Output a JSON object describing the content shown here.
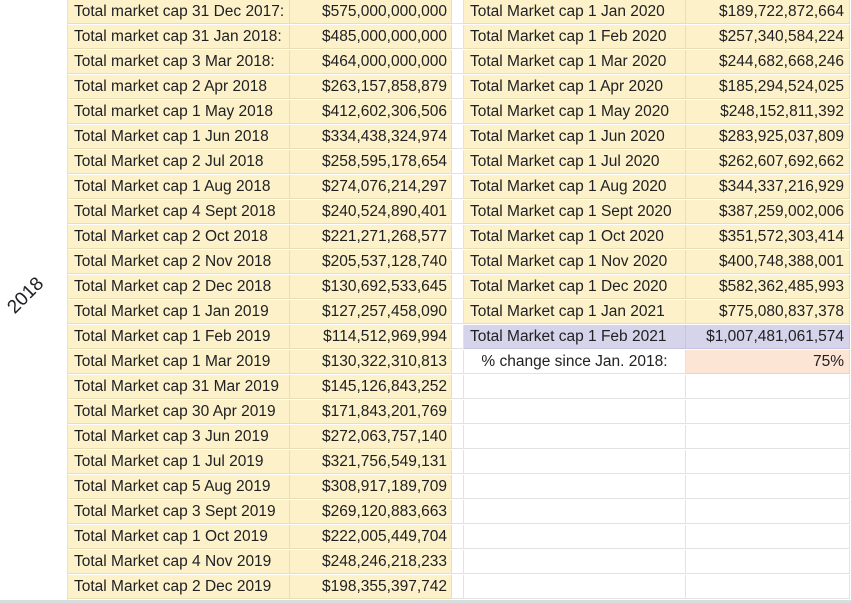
{
  "group_label": "2018",
  "left_table": [
    {
      "label": "Total market cap 31 Dec 2017:",
      "value": "$575,000,000,000"
    },
    {
      "label": "Total market cap 31 Jan 2018:",
      "value": "$485,000,000,000"
    },
    {
      "label": "Total market cap 3 Mar 2018:",
      "value": "$464,000,000,000"
    },
    {
      "label": "Total market cap 2 Apr 2018",
      "value": "$263,157,858,879"
    },
    {
      "label": "Total market cap 1 May 2018",
      "value": "$412,602,306,506"
    },
    {
      "label": "Total Market cap 1 Jun 2018",
      "value": "$334,438,324,974"
    },
    {
      "label": "Total Market cap 2 Jul 2018",
      "value": "$258,595,178,654"
    },
    {
      "label": "Total Market cap 1 Aug 2018",
      "value": "$274,076,214,297"
    },
    {
      "label": "Total Market cap 4 Sept 2018",
      "value": "$240,524,890,401"
    },
    {
      "label": "Total Market cap 2 Oct 2018",
      "value": "$221,271,268,577"
    },
    {
      "label": "Total Market cap 2 Nov 2018",
      "value": "$205,537,128,740"
    },
    {
      "label": "Total Market cap 2 Dec 2018",
      "value": "$130,692,533,645"
    },
    {
      "label": "Total Market cap 1 Jan 2019",
      "value": "$127,257,458,090"
    },
    {
      "label": "Total Market cap 1 Feb 2019",
      "value": "$114,512,969,994"
    },
    {
      "label": "Total Market cap 1 Mar 2019",
      "value": "$130,322,310,813"
    },
    {
      "label": "Total Market cap 31 Mar 2019",
      "value": "$145,126,843,252"
    },
    {
      "label": "Total Market cap 30 Apr 2019",
      "value": "$171,843,201,769"
    },
    {
      "label": "Total Market cap 3 Jun 2019",
      "value": "$272,063,757,140"
    },
    {
      "label": "Total Market cap 1 Jul 2019",
      "value": "$321,756,549,131"
    },
    {
      "label": "Total Market cap 5 Aug 2019",
      "value": "$308,917,189,709"
    },
    {
      "label": "Total Market cap 3 Sept 2019",
      "value": "$269,120,883,663"
    },
    {
      "label": "Total Market cap 1 Oct 2019",
      "value": "$222,005,449,704"
    },
    {
      "label": "Total Market cap 4 Nov 2019",
      "value": "$248,246,218,233"
    },
    {
      "label": "Total Market cap 2 Dec 2019",
      "value": "$198,355,397,742"
    }
  ],
  "right_table": [
    {
      "label": "Total Market cap 1 Jan 2020",
      "value": "$189,722,872,664"
    },
    {
      "label": "Total Market cap 1 Feb 2020",
      "value": "$257,340,584,224"
    },
    {
      "label": "Total Market cap 1 Mar 2020",
      "value": "$244,682,668,246"
    },
    {
      "label": "Total Market cap 1 Apr 2020",
      "value": "$185,294,524,025"
    },
    {
      "label": "Total Market cap 1 May 2020",
      "value": "$248,152,811,392"
    },
    {
      "label": "Total Market cap 1 Jun 2020",
      "value": "$283,925,037,809"
    },
    {
      "label": "Total Market cap 1 Jul 2020",
      "value": "$262,607,692,662"
    },
    {
      "label": "Total Market cap 1 Aug 2020",
      "value": "$344,337,216,929"
    },
    {
      "label": "Total Market cap 1 Sept 2020",
      "value": "$387,259,002,006"
    },
    {
      "label": "Total Market cap 1 Oct 2020",
      "value": "$351,572,303,414"
    },
    {
      "label": "Total Market cap 1 Nov 2020",
      "value": "$400,748,388,001"
    },
    {
      "label": "Total Market cap 1 Dec 2020",
      "value": "$582,362,485,993"
    },
    {
      "label": "Total Market cap 1 Jan 2021",
      "value": "$775,080,837,378"
    },
    {
      "label": "Total Market cap 1 Feb 2021",
      "value": "$1,007,481,061,574"
    }
  ],
  "summary": {
    "label": "% change since Jan. 2018:",
    "value": "75%"
  },
  "colors": {
    "yellow_fill": "#fdf1c9",
    "purple_fill": "#d6d4ea",
    "orange_fill": "#fce5d4",
    "grid_line": "#e2e2e2"
  }
}
